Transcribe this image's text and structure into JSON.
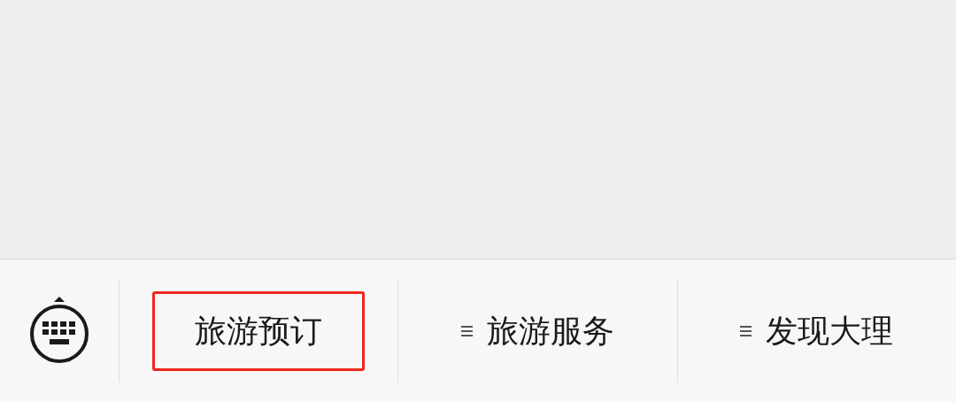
{
  "menu_bar": {
    "items": [
      {
        "label": "旅游预订",
        "has_submenu": false,
        "highlighted": true
      },
      {
        "label": "旅游服务",
        "has_submenu": true,
        "highlighted": false
      },
      {
        "label": "发现大理",
        "has_submenu": true,
        "highlighted": false
      }
    ]
  }
}
